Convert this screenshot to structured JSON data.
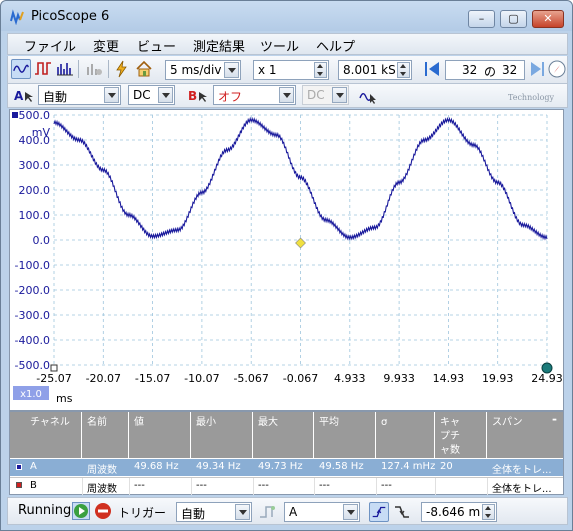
{
  "window": {
    "title": "PicoScope 6",
    "min": "–",
    "max": "▢",
    "close": "✕"
  },
  "menu": [
    "ファイル",
    "変更",
    "ビュー",
    "測定結果",
    "ツール",
    "ヘルプ"
  ],
  "toolbar": {
    "timebase": "5 ms/div",
    "zoom": "x 1",
    "samples": "8.001 kS",
    "buffer_current": "32",
    "buffer_of": "の",
    "buffer_total": "32"
  },
  "channels": {
    "a": {
      "label": "A",
      "range": "自動",
      "coupling": "DC",
      "color": "#1a1a9c"
    },
    "b": {
      "label": "B",
      "range": "オフ",
      "coupling": "DC",
      "color": "#d02020"
    }
  },
  "brand_watermark": "Technology",
  "scope": {
    "y_unit": "mV",
    "y_ticks": [
      "500.0",
      "400.0",
      "300.0",
      "200.0",
      "100.0",
      "0.0",
      "-100.0",
      "-200.0",
      "-300.0",
      "-400.0",
      "-500.0"
    ],
    "x_ticks": [
      "-25.07",
      "-20.07",
      "-15.07",
      "-10.07",
      "-5.067",
      "-0.067",
      "4.933",
      "9.933",
      "14.93",
      "19.93",
      "24.93"
    ],
    "x_unit": "ms",
    "zoom_badge": "x1.0",
    "trace_color": "#1a1a9c",
    "trigger_color": "#f0e040"
  },
  "chart_data": {
    "type": "line",
    "title": "",
    "xlabel": "ms",
    "ylabel": "mV",
    "xlim": [
      -25.07,
      24.93
    ],
    "ylim": [
      -500,
      500
    ],
    "grid": true,
    "series": [
      {
        "name": "A",
        "x": [
          -25.07,
          -22.5,
          -20.07,
          -17.5,
          -15.07,
          -12.5,
          -10.07,
          -7.5,
          -5.07,
          -2.5,
          -0.07,
          2.5,
          4.93,
          7.5,
          9.93,
          12.5,
          14.93,
          17.5,
          19.93,
          22.5,
          24.93
        ],
        "y": [
          470,
          400,
          280,
          100,
          15,
          40,
          190,
          360,
          480,
          420,
          250,
          80,
          10,
          50,
          230,
          400,
          480,
          380,
          230,
          60,
          10
        ]
      }
    ],
    "trigger_marker": {
      "x": -0.067,
      "y": 0
    }
  },
  "measurements": {
    "headers": [
      "チャネル",
      "名前",
      "値",
      "最小",
      "最大",
      "平均",
      "σ",
      "キャプチャ数",
      "スパン"
    ],
    "rows": [
      [
        "A",
        "周波数",
        "49.68 Hz",
        "49.34 Hz",
        "49.73 Hz",
        "49.58 Hz",
        "127.4 mHz",
        "20",
        "全体をトレ..."
      ],
      [
        "B",
        "周波数",
        "---",
        "---",
        "---",
        "---",
        "---",
        "",
        "全体をトレ..."
      ]
    ],
    "collapse": "-"
  },
  "statusbar": {
    "state": "Running",
    "trigger_label": "トリガー",
    "trigger_mode": "自動",
    "trigger_source": "A",
    "trigger_level": "-8.646 m"
  }
}
